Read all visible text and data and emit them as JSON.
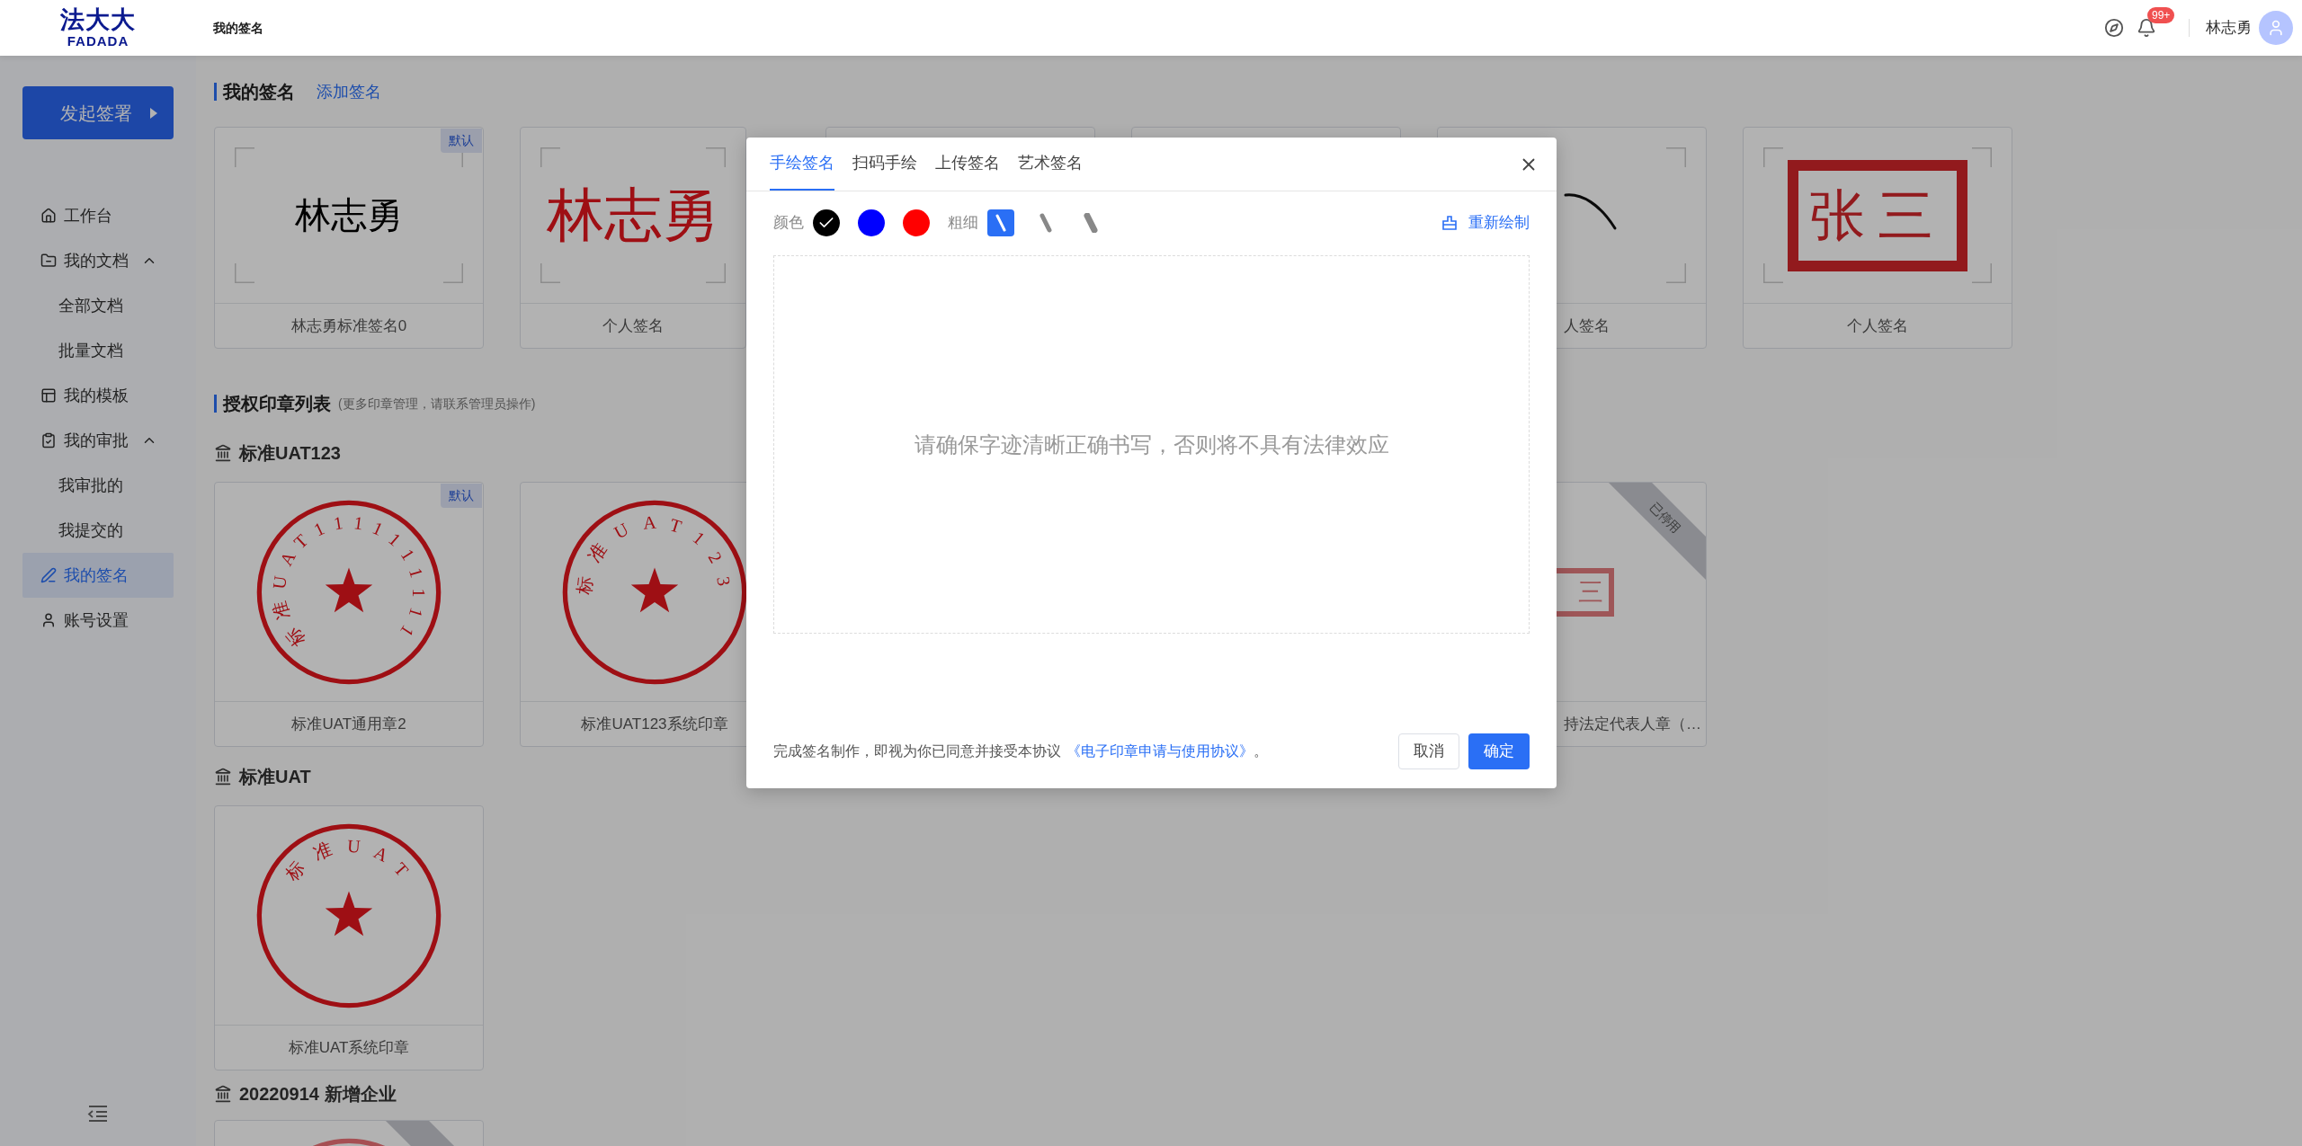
{
  "header": {
    "logo_cn": "法大大",
    "logo_en": "FADADA",
    "page_title": "我的签名",
    "notification_badge": "99+",
    "user_name": "林志勇"
  },
  "sidebar": {
    "primary_button": "发起签署",
    "items": [
      {
        "label": "工作台",
        "selected": false
      },
      {
        "label": "我的文档",
        "selected": false,
        "expanded": true,
        "children": [
          {
            "label": "全部文档",
            "selected": false
          },
          {
            "label": "批量文档",
            "selected": false
          }
        ]
      },
      {
        "label": "我的模板",
        "selected": false
      },
      {
        "label": "我的审批",
        "selected": false,
        "expanded": true,
        "children": [
          {
            "label": "我审批的",
            "selected": false
          },
          {
            "label": "我提交的",
            "selected": false
          }
        ]
      },
      {
        "label": "我的签名",
        "selected": true
      },
      {
        "label": "账号设置",
        "selected": false
      }
    ]
  },
  "my_signatures": {
    "title": "我的签名",
    "add_link": "添加签名",
    "cards": [
      {
        "kind": "black_text",
        "text": "林志勇",
        "label": "林志勇标准签名0",
        "badge": "默认"
      },
      {
        "kind": "red_text",
        "text": "林志勇",
        "label": "个人签名"
      },
      {
        "kind": "stroke",
        "label": "人签名"
      },
      {
        "kind": "seal",
        "text": "张三",
        "label": "个人签名"
      }
    ]
  },
  "seal_list": {
    "title": "授权印章列表",
    "note": "(更多印章管理，请联系管理员操作)",
    "companies": [
      {
        "name": "标准UAT123",
        "cards": [
          {
            "kind": "round",
            "arc_text": "标准UAT1111111111",
            "label": "标准UAT通用章2",
            "badge": "默认",
            "disabled": false
          },
          {
            "kind": "round",
            "arc_text": "标准UAT123",
            "label": "标准UAT123系统印章",
            "disabled": false
          },
          {
            "kind": "seal",
            "text": "三",
            "label": "持法定代表人章（…",
            "disabled": true,
            "ribbon": "已停用"
          }
        ]
      },
      {
        "name": "标准UAT",
        "cards": [
          {
            "kind": "round",
            "arc_text": "标准UAT",
            "label": "标准UAT系统印章",
            "disabled": false
          }
        ]
      },
      {
        "name": "20220914 新增企业",
        "cards": [
          {
            "kind": "round",
            "disabled": true
          }
        ]
      }
    ]
  },
  "dialog": {
    "tabs": [
      {
        "label": "手绘签名",
        "selected": true
      },
      {
        "label": "扫码手绘",
        "selected": false
      },
      {
        "label": "上传签名",
        "selected": false
      },
      {
        "label": "艺术签名",
        "selected": false
      }
    ],
    "color_label": "颜色",
    "colors": [
      {
        "color": "#000000",
        "selected": true
      },
      {
        "color": "#0000ff",
        "selected": false
      },
      {
        "color": "#ff0000",
        "selected": false
      }
    ],
    "thickness_label": "粗细",
    "thicknesses": [
      {
        "kind": "thin",
        "selected": true
      },
      {
        "kind": "medium",
        "selected": false
      },
      {
        "kind": "thick",
        "selected": false
      }
    ],
    "redraw_button": "重新绘制",
    "canvas_placeholder": "请确保字迹清晰正确书写，否则将不具有法律效应",
    "agreement_text": "完成签名制作，即视为你已同意并接受本协议",
    "agreement_link": "《电子印章申请与使用协议》",
    "agreement_end": "。",
    "buttons": [
      {
        "kind": "secondary",
        "label": "取消"
      },
      {
        "kind": "primary",
        "label": "确定"
      }
    ]
  }
}
